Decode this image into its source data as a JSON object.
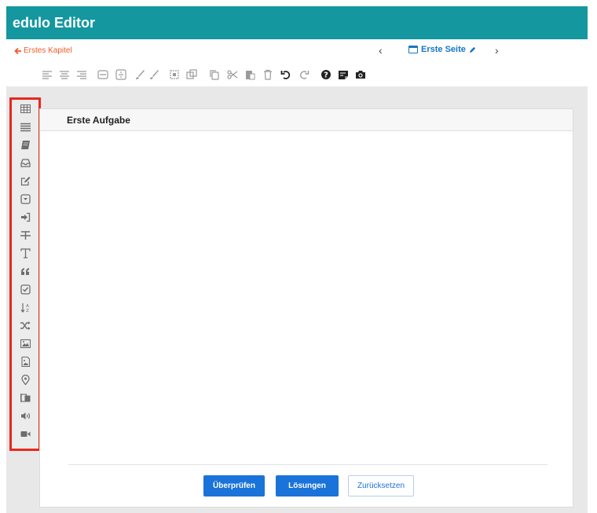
{
  "app": {
    "title": "edulo Editor"
  },
  "colors": {
    "appbar": "#14979f",
    "back_link": "#f05a28",
    "accent": "#1a73d9",
    "highlight_border": "#e8281d"
  },
  "nav": {
    "back_label": "Erstes Kapitel",
    "back_icon": "arrow-left-icon",
    "prev_icon": "chevron-left-icon",
    "next_icon": "chevron-right-icon",
    "page_label": "Erste Seite",
    "page_icon": "window-icon",
    "edit_icon": "pencil-icon"
  },
  "toolbar": {
    "icons": [
      "align-left-icon",
      "align-center-icon",
      "align-right-icon",
      "horizontal-rule-icon",
      "vertical-spacing-icon",
      "brush-icon",
      "paint-brush-icon",
      "select-frame-icon",
      "resize-icon",
      "copy-icon",
      "cut-icon",
      "paste-icon",
      "delete-icon",
      "undo-icon",
      "redo-icon",
      "help-icon",
      "note-icon",
      "camera-icon"
    ]
  },
  "palette": {
    "icons": [
      "table-icon",
      "list-lines-icon",
      "book-icon",
      "inbox-icon",
      "edit-square-icon",
      "dropdown-icon",
      "sign-in-icon",
      "text-strikethrough-icon",
      "text-type-icon",
      "quote-icon",
      "checkbox-icon",
      "sort-alpha-icon",
      "shuffle-icon",
      "image-icon",
      "image-file-icon",
      "map-marker-icon",
      "image-compare-icon",
      "volume-icon",
      "video-icon"
    ]
  },
  "card": {
    "title": "Erste Aufgabe",
    "buttons": {
      "check_label": "Überprüfen",
      "solutions_label": "Lösungen",
      "reset_label": "Zurücksetzen"
    }
  }
}
